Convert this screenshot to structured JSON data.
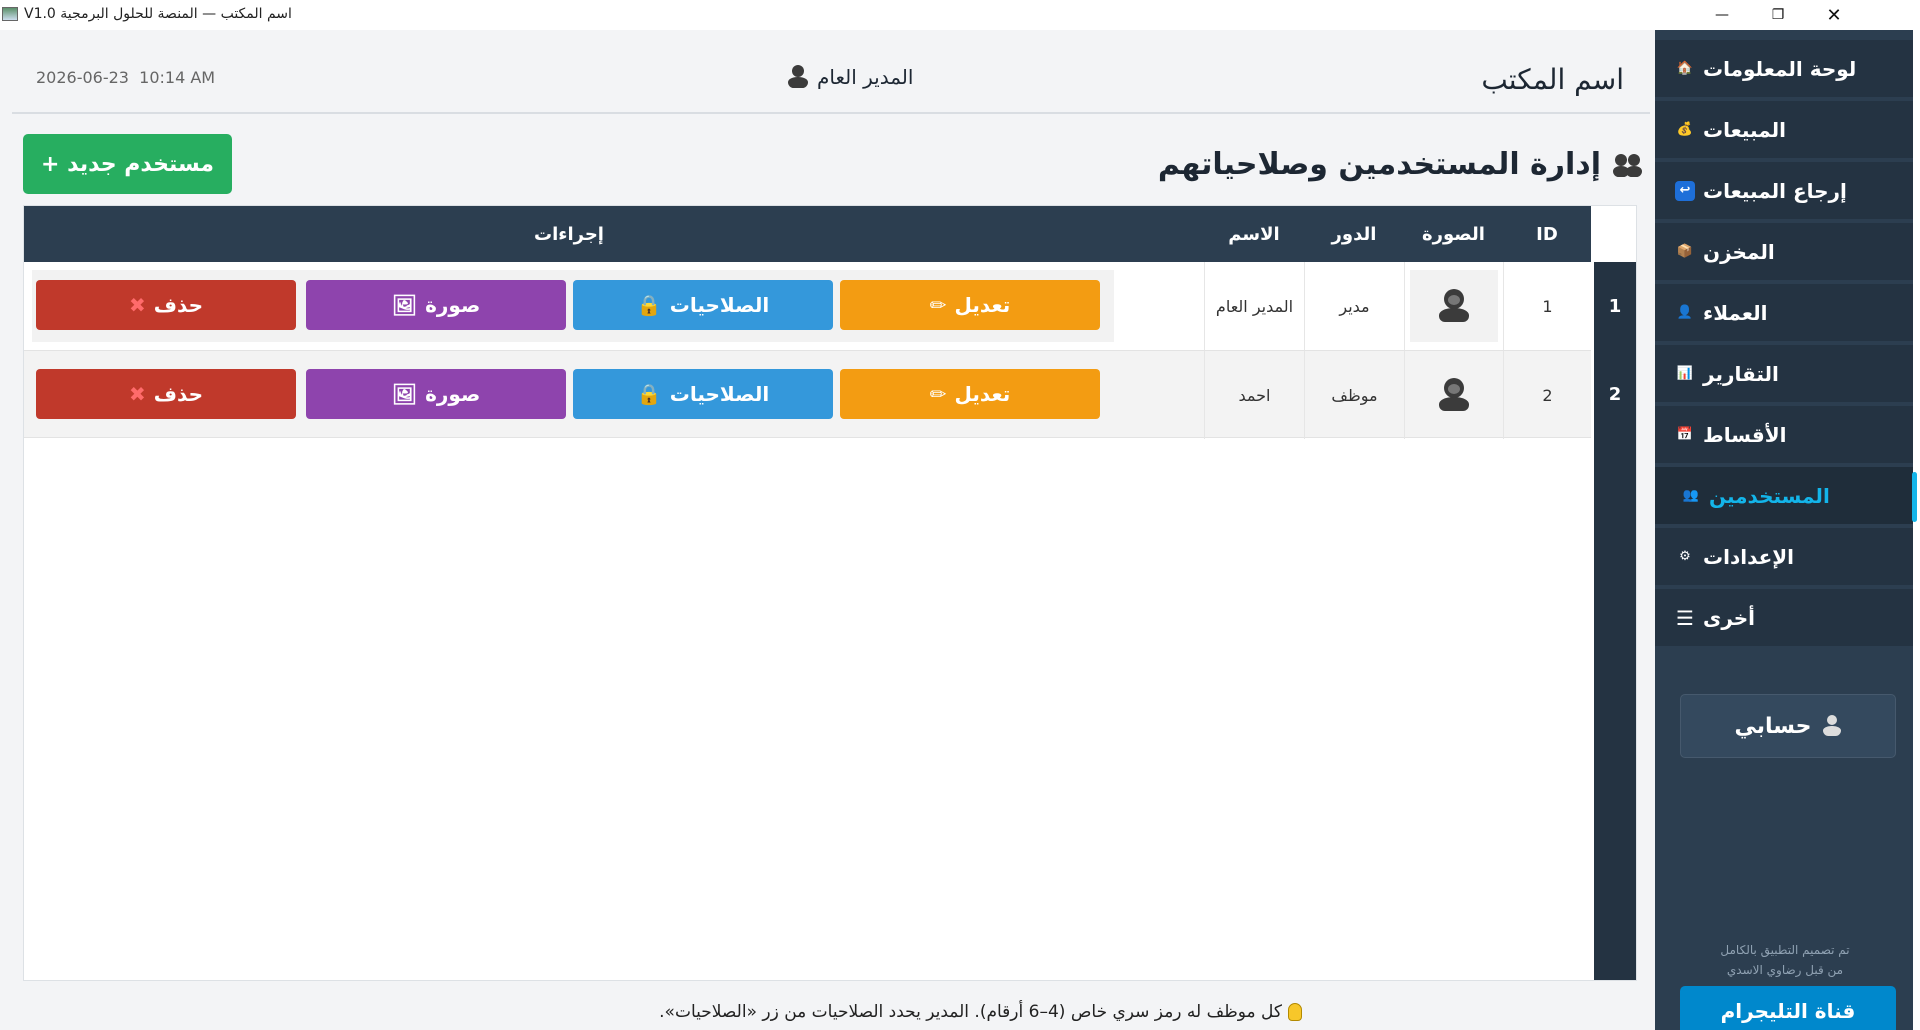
{
  "window": {
    "title": "V1.0 اسم المكتب — المنصة للحلول البرمجية",
    "minimize": "—",
    "maximize": "❐",
    "close": "✕"
  },
  "sidebar": {
    "items": [
      {
        "label": "لوحة المعلومات",
        "icon": "house-icon",
        "glyph": "🏠"
      },
      {
        "label": "المبيعات",
        "icon": "money-bag-icon",
        "glyph": "💰"
      },
      {
        "label": "إرجاع المبيعات",
        "icon": "return-arrow-icon",
        "glyph": "↩"
      },
      {
        "label": "المخزن",
        "icon": "box-icon",
        "glyph": "📦"
      },
      {
        "label": "العملاء",
        "icon": "person-icon",
        "glyph": "👤"
      },
      {
        "label": "التقارير",
        "icon": "bar-chart-icon",
        "glyph": "📊"
      },
      {
        "label": "الأقساط",
        "icon": "calendar-icon",
        "glyph": "📅"
      },
      {
        "label": "المستخدمين",
        "icon": "users-icon",
        "glyph": "👥",
        "active": true
      },
      {
        "label": "الإعدادات",
        "icon": "gear-icon",
        "glyph": "⚙"
      },
      {
        "label": "أخرى",
        "icon": "menu-icon",
        "glyph": "☰"
      }
    ],
    "account_label": "حسابي",
    "credit_line1": "تم تصميم التطبيق بالكامل",
    "credit_line2": "من قبل رضاوي الاسدي",
    "telegram_label": "قناة التليجرام",
    "active_color": "#13b5ea"
  },
  "header": {
    "office_name": "اسم المكتب",
    "user_name": "المدير العام",
    "date": "2026-06-23",
    "time": "10:14 AM"
  },
  "page": {
    "heading": "إدارة المستخدمين وصلاحياتهم",
    "new_user_label": "مستخدم جديد +"
  },
  "table": {
    "columns": {
      "id": "ID",
      "photo": "الصورة",
      "role": "الدور",
      "name": "الاسم",
      "actions": "إجراءات"
    },
    "rows": [
      {
        "num": "1",
        "id": "1",
        "role": "مدير",
        "name": "المدير العام"
      },
      {
        "num": "2",
        "id": "2",
        "role": "موظف",
        "name": "احمد"
      }
    ],
    "actions": {
      "edit": "تعديل",
      "permissions": "الصلاحيات",
      "photo": "صورة",
      "delete": "حذف"
    }
  },
  "hint": "كل موظف له رمز سري خاص (4–6 أرقام). المدير يحدد الصلاحيات من زر «الصلاحيات».",
  "colors": {
    "sidebar_bg": "#2c3e50",
    "new_user": "#27ae60",
    "edit": "#f39c12",
    "permissions": "#3498db",
    "photo": "#8e44ad",
    "delete": "#c0392b",
    "telegram": "#0088cc"
  }
}
